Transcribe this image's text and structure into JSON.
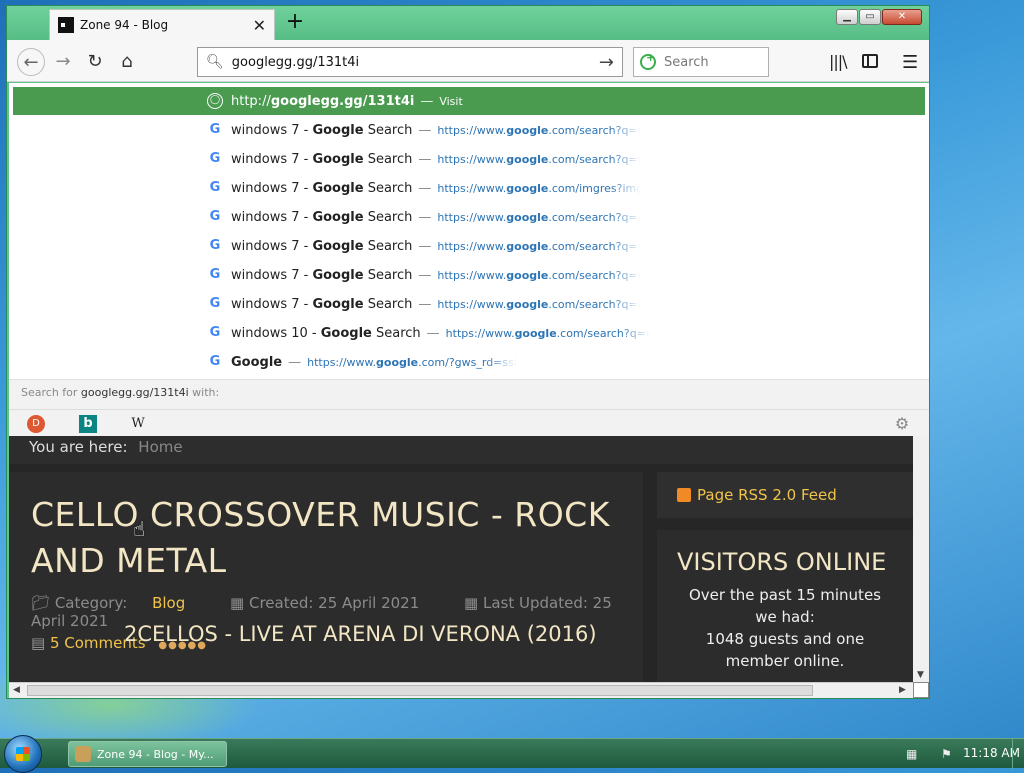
{
  "browser": {
    "tab": {
      "title": "Zone 94 - Blog",
      "favicon": "zone94-favicon",
      "close": "✕"
    },
    "new_tab": "+",
    "window_controls": {
      "minimize": "▁",
      "maximize": "▭",
      "close": "✕"
    },
    "nav": {
      "back": "←",
      "forward": "→",
      "reload": "↻",
      "home": "⌂"
    },
    "urlbar": {
      "value": "googlegg.gg/131t4i",
      "go": "→"
    },
    "searchbox": {
      "placeholder": "Search"
    },
    "toolbar": {
      "library": "|||\\",
      "menu": "☰"
    }
  },
  "dropdown": {
    "selected": {
      "prefix": "http://",
      "bold": "googlegg.gg/131t4i",
      "sep": "—",
      "action": "Visit"
    },
    "suggestions": [
      {
        "pre": "windows 7 - ",
        "bold": "Google",
        "post": " Search",
        "url_pre": "https://www.",
        "url_bold": "google",
        "url_post": ".com/search?q=wi"
      },
      {
        "pre": "windows 7 - ",
        "bold": "Google",
        "post": " Search",
        "url_pre": "https://www.",
        "url_bold": "google",
        "url_post": ".com/search?q=wi"
      },
      {
        "pre": "windows 7 - ",
        "bold": "Google",
        "post": " Search",
        "url_pre": "https://www.",
        "url_bold": "google",
        "url_post": ".com/imgres?imgu"
      },
      {
        "pre": "windows 7 - ",
        "bold": "Google",
        "post": " Search",
        "url_pre": "https://www.",
        "url_bold": "google",
        "url_post": ".com/search?q=wi"
      },
      {
        "pre": "windows 7 - ",
        "bold": "Google",
        "post": " Search",
        "url_pre": "https://www.",
        "url_bold": "google",
        "url_post": ".com/search?q=wi"
      },
      {
        "pre": "windows 7 - ",
        "bold": "Google",
        "post": " Search",
        "url_pre": "https://www.",
        "url_bold": "google",
        "url_post": ".com/search?q=wi"
      },
      {
        "pre": "windows 7 - ",
        "bold": "Google",
        "post": " Search",
        "url_pre": "https://www.",
        "url_bold": "google",
        "url_post": ".com/search?q=wi"
      },
      {
        "pre": "windows 10 - ",
        "bold": "Google",
        "post": " Search",
        "url_pre": "https://www.",
        "url_bold": "google",
        "url_post": ".com/search?q=w"
      },
      {
        "pre": "",
        "bold": "Google",
        "post": "",
        "url_pre": "https://www.",
        "url_bold": "google",
        "url_post": ".com/?gws_rd=ssl"
      }
    ],
    "separator": "—",
    "search_with": {
      "prefix": "Search for ",
      "query": "googlegg.gg/131t4i",
      "suffix": " with:"
    },
    "engines": [
      "duckduckgo",
      "bing",
      "wikipedia"
    ],
    "engine_glyphs": {
      "duckduckgo": "D",
      "bing": "b",
      "wikipedia": "W",
      "settings": "⚙"
    }
  },
  "page": {
    "breadcrumb": {
      "label": "You are here:",
      "home": "Home"
    },
    "article": {
      "title": "CELLO CROSSOVER MUSIC - ROCK AND METAL",
      "category_label": "Category:",
      "category": "Blog",
      "created": "Created: 25 April 2021",
      "updated": "Last Updated: 25 April 2021",
      "comments": "5 Comments",
      "rating": "●●●●●",
      "video_title": "2CELLOS - LIVE AT ARENA DI VERONA (2016)"
    },
    "sidebar": {
      "rss": "Page RSS 2.0 Feed",
      "visitors_title": "VISITORS ONLINE",
      "visitors_text": "Over the past 15 minutes we had:",
      "visitors_count": "1048 guests and one member online."
    }
  },
  "taskbar": {
    "task_label": "Zone 94 - Blog - My...",
    "clock": "11:18 AM"
  },
  "colors": {
    "window_frame": "#5fc48e",
    "selected_row": "#4a9a50",
    "accent_link": "#f0c44a",
    "heading": "#f3e6c4"
  }
}
